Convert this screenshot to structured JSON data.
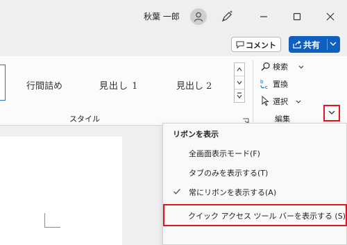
{
  "titlebar": {
    "user_name": "秋葉 一郎"
  },
  "toolbar": {
    "comment_label": "コメント",
    "share_label": "共有"
  },
  "ribbon": {
    "styles": [
      "行間詰め",
      "見出し 1",
      "見出し 2"
    ],
    "styles_group_label": "スタイル",
    "editing": {
      "find_label": "検索",
      "replace_label": "置換",
      "select_label": "選択",
      "group_label": "編集"
    }
  },
  "menu": {
    "header": "リボンを表示",
    "items": [
      {
        "label": "全画面表示モード(F)",
        "checked": false
      },
      {
        "label": "タブのみを表示する(T)",
        "checked": false
      },
      {
        "label": "常にリボンを表示する(A)",
        "checked": true
      },
      {
        "label": "クイック アクセス ツール バーを表示する (S)",
        "checked": false,
        "highlighted": true
      }
    ]
  },
  "colors": {
    "accent": "#0f5fbf",
    "highlight_box": "#e8121e",
    "background": "#efefef"
  }
}
